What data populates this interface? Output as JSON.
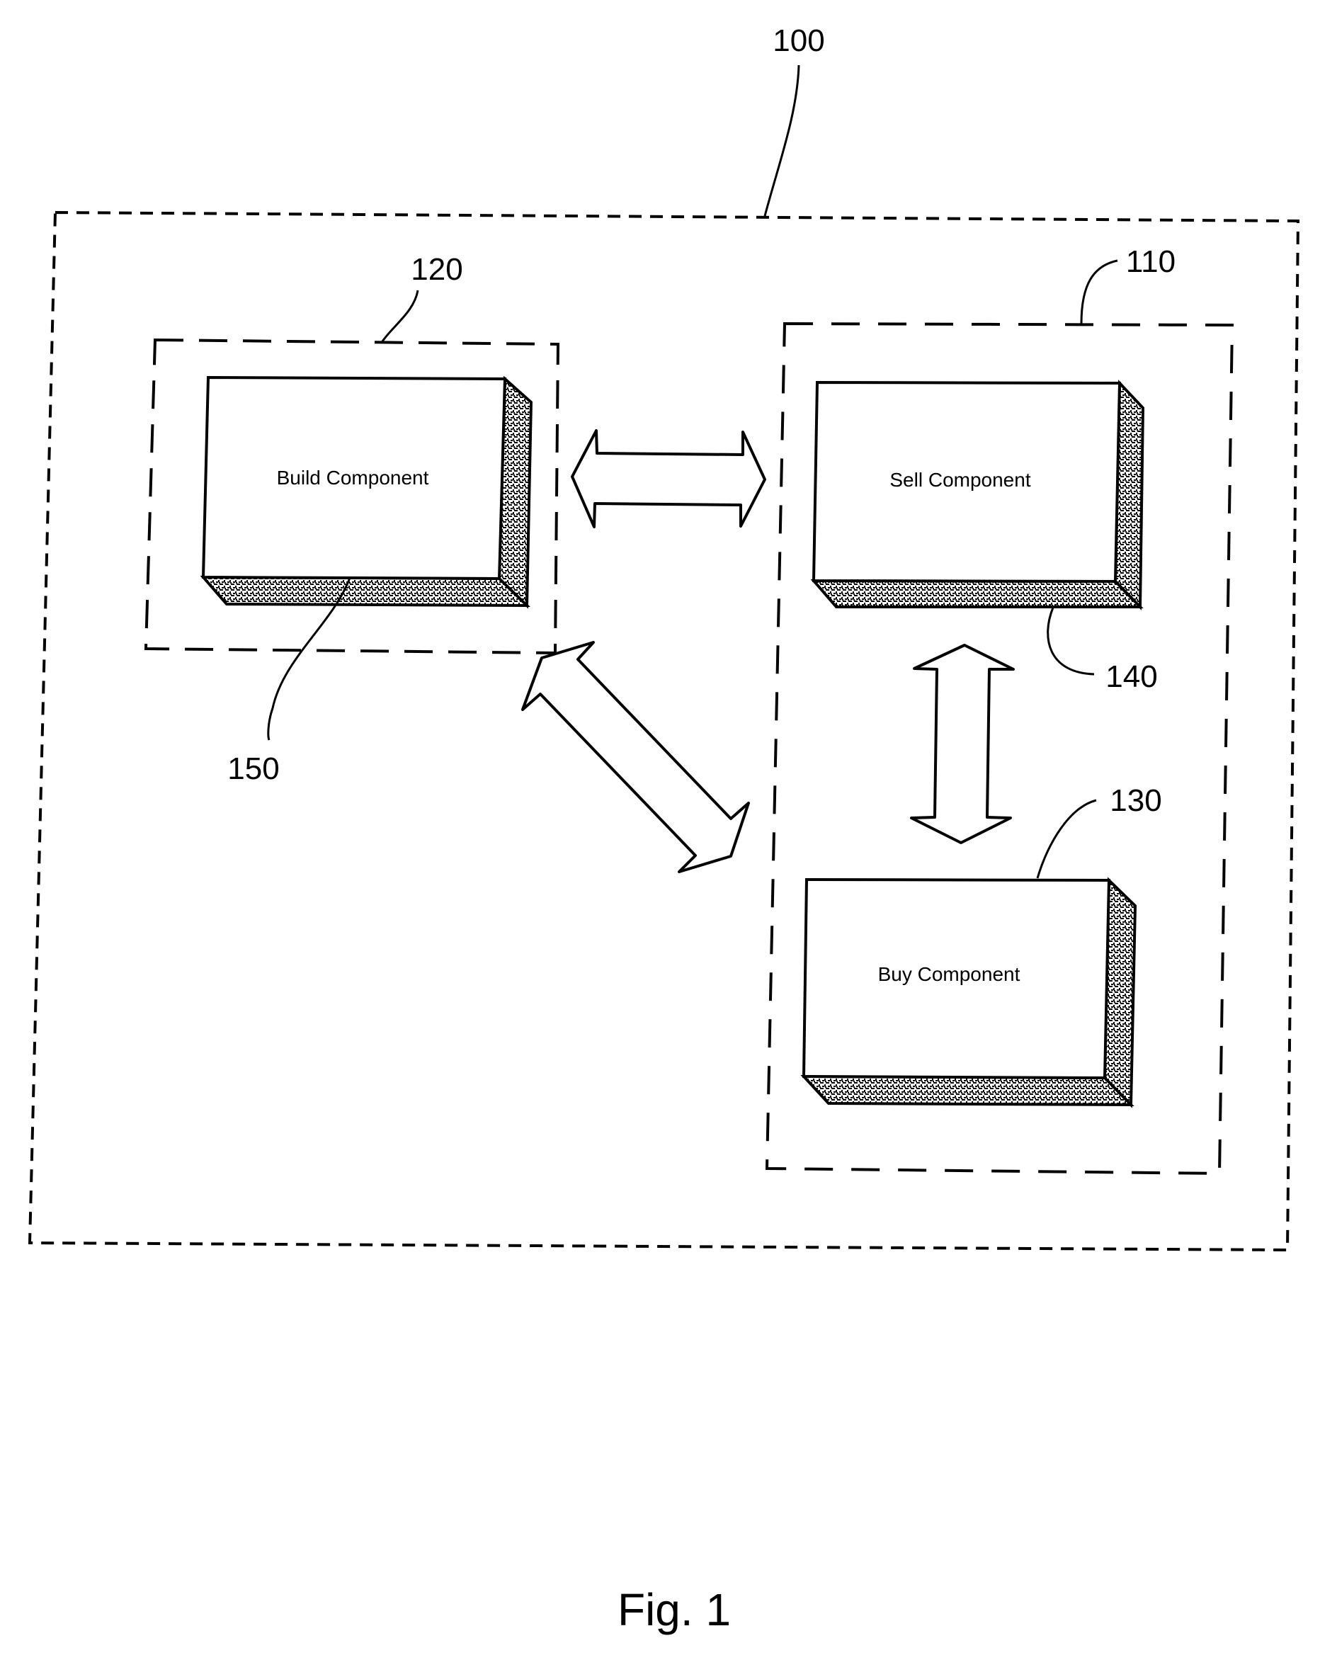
{
  "figure": {
    "caption": "Fig. 1",
    "colors": {
      "ink": "#000000",
      "paper": "#ffffff",
      "shade": "#6b6b6b"
    },
    "reference_numerals": {
      "system": "100",
      "sell_group": "110",
      "build_group": "120",
      "buy": "130",
      "sell": "140",
      "build": "150"
    },
    "components": [
      {
        "id": "build",
        "label": "Build Component",
        "ref": "150",
        "group": "120"
      },
      {
        "id": "sell",
        "label": "Sell Component",
        "ref": "140",
        "group": "110"
      },
      {
        "id": "buy",
        "label": "Buy Component",
        "ref": "130",
        "group": "110"
      }
    ],
    "connections": [
      {
        "from": "build",
        "to": "sell",
        "type": "bidirectional"
      },
      {
        "from": "build",
        "to": "buy",
        "type": "bidirectional"
      },
      {
        "from": "sell",
        "to": "buy",
        "type": "bidirectional"
      }
    ]
  }
}
